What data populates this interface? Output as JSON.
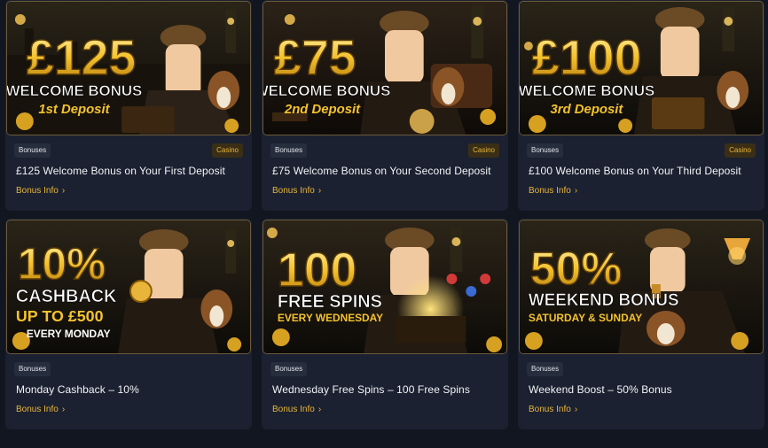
{
  "colors": {
    "page_bg": "#121620",
    "card_bg": "#1b2130",
    "accent": "#e8b53a"
  },
  "cards": [
    {
      "banner": {
        "big": "£125",
        "line1": "WELCOME BONUS",
        "line2": "1st Deposit",
        "line3": ""
      },
      "tag_left": "Bonuses",
      "tag_right": "Casino",
      "title": "£125 Welcome Bonus on Your First Deposit",
      "link": "Bonus Info"
    },
    {
      "banner": {
        "big": "£75",
        "line1": "WELCOME BONUS",
        "line2": "2nd Deposit",
        "line3": ""
      },
      "tag_left": "Bonuses",
      "tag_right": "Casino",
      "title": "£75 Welcome Bonus on Your Second Deposit",
      "link": "Bonus Info"
    },
    {
      "banner": {
        "big": "£100",
        "line1": "WELCOME BONUS",
        "line2": "3rd Deposit",
        "line3": ""
      },
      "tag_left": "Bonuses",
      "tag_right": "Casino",
      "title": "£100 Welcome Bonus on Your Third Deposit",
      "link": "Bonus Info"
    },
    {
      "banner": {
        "big": "10%",
        "line1": "CASHBACK",
        "line2": "UP TO £500",
        "line3": "EVERY MONDAY"
      },
      "tag_left": "Bonuses",
      "tag_right": "",
      "title": "Monday Cashback – 10%",
      "link": "Bonus Info"
    },
    {
      "banner": {
        "big": "100",
        "line1": "FREE SPINS",
        "line2": "EVERY WEDNESDAY",
        "line3": ""
      },
      "tag_left": "Bonuses",
      "tag_right": "",
      "title": "Wednesday Free Spins – 100 Free Spins",
      "link": "Bonus Info"
    },
    {
      "banner": {
        "big": "50%",
        "line1": "WEEKEND BONUS",
        "line2": "SATURDAY & SUNDAY",
        "line3": ""
      },
      "tag_left": "Bonuses",
      "tag_right": "",
      "title": "Weekend Boost – 50% Bonus",
      "link": "Bonus Info"
    }
  ]
}
